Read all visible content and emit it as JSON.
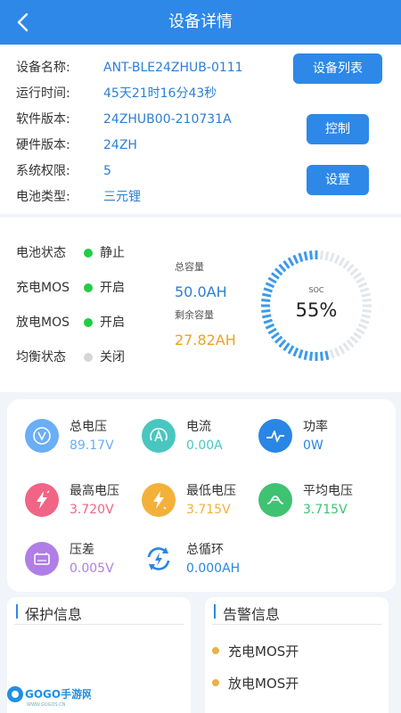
{
  "header": {
    "title": "设备详情"
  },
  "info": {
    "rows": [
      {
        "label": "设备名称:",
        "value": "ANT-BLE24ZHUB-0111"
      },
      {
        "label": "运行时间:",
        "value": "45天21时16分43秒"
      },
      {
        "label": "软件版本:",
        "value": "24ZHUB00-210731A"
      },
      {
        "label": "硬件版本:",
        "value": "24ZH"
      },
      {
        "label": "系统权限:",
        "value": "5"
      },
      {
        "label": "电池类型:",
        "value": "三元锂"
      }
    ],
    "buttons": {
      "device_list": "设备列表",
      "control": "控制",
      "settings": "设置"
    }
  },
  "status": {
    "items": [
      {
        "label": "电池状态",
        "value": "静止",
        "dot_color": "#22cc44"
      },
      {
        "label": "充电MOS",
        "value": "开启",
        "dot_color": "#22cc44"
      },
      {
        "label": "放电MOS",
        "value": "开启",
        "dot_color": "#22cc44"
      },
      {
        "label": "均衡状态",
        "value": "关闭",
        "dot_color": "#d6d6d6"
      }
    ],
    "total_capacity_label": "总容量",
    "total_capacity": "50.0AH",
    "remaining_capacity_label": "剩余容量",
    "remaining_capacity": "27.82AH",
    "soc_label": "SOC",
    "soc_text": "55%",
    "soc_fraction": 0.55
  },
  "metrics": [
    {
      "label": "总电压",
      "value": "89.17V",
      "icon": "voltage-icon",
      "color": "#6aaef6"
    },
    {
      "label": "电流",
      "value": "0.00A",
      "icon": "current-icon",
      "color": "#4ac6c0"
    },
    {
      "label": "功率",
      "value": "0W",
      "icon": "power-icon",
      "color": "#2a86e4"
    },
    {
      "label": "最高电压",
      "value": "3.720V",
      "icon": "max-voltage-icon",
      "color": "#f06585"
    },
    {
      "label": "最低电压",
      "value": "3.715V",
      "icon": "min-voltage-icon",
      "color": "#f3b13a"
    },
    {
      "label": "平均电压",
      "value": "3.715V",
      "icon": "avg-voltage-icon",
      "color": "#3fc272"
    },
    {
      "label": "压差",
      "value": "0.005V",
      "icon": "voltage-diff-icon",
      "color": "#b07ee6"
    },
    {
      "label": "总循环",
      "value": "0.000AH",
      "icon": "cycle-icon",
      "color": "#2a86e4"
    }
  ],
  "protection": {
    "title": "保护信息"
  },
  "alarm": {
    "title": "告警信息",
    "items": [
      "充电MOS开",
      "放电MOS开"
    ]
  },
  "watermark": {
    "text": "GOGO手游网",
    "sub": "WWW.GOGOS.CN"
  }
}
